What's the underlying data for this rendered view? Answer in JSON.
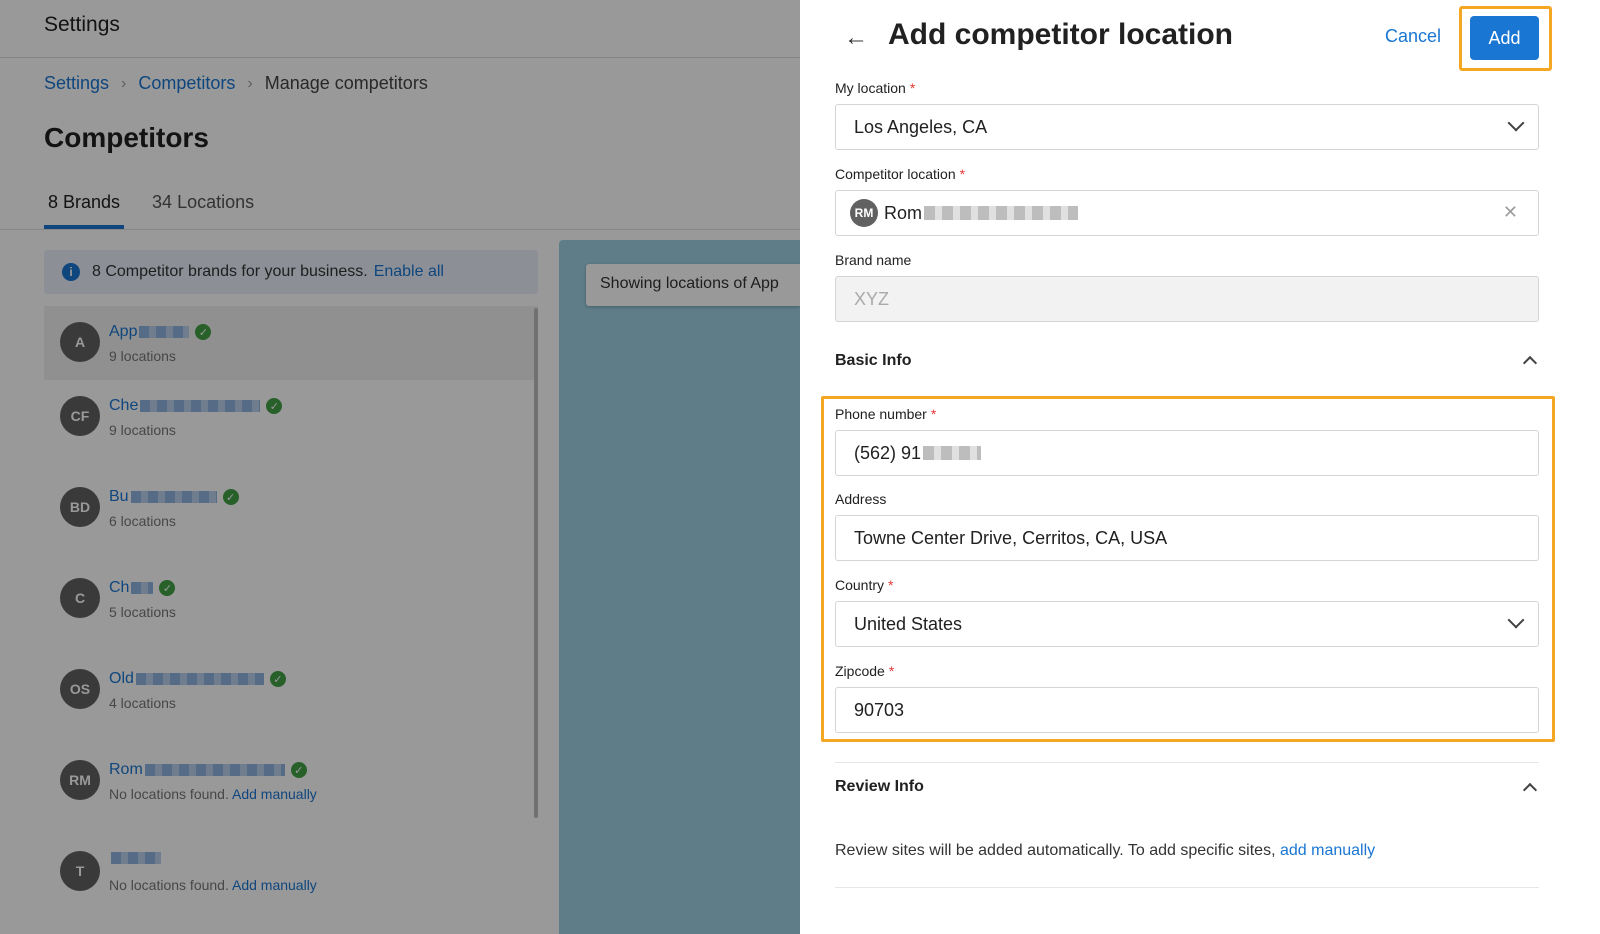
{
  "background": {
    "top_title": "Settings",
    "breadcrumb": [
      "Settings",
      "Competitors",
      "Manage competitors"
    ],
    "page_title": "Competitors",
    "tabs": [
      {
        "label": "8 Brands"
      },
      {
        "label": "34 Locations"
      }
    ],
    "info": {
      "text": "8 Competitor brands for your business.",
      "link": "Enable all"
    },
    "brands": [
      {
        "initials": "A",
        "name": "App",
        "sub": "9 locations",
        "add_link": ""
      },
      {
        "initials": "CF",
        "name": "Che",
        "sub": "9 locations",
        "add_link": ""
      },
      {
        "initials": "BD",
        "name": "Bu",
        "sub": "6 locations",
        "add_link": ""
      },
      {
        "initials": "C",
        "name": "Ch",
        "sub": "5 locations",
        "add_link": ""
      },
      {
        "initials": "OS",
        "name": "Old",
        "sub": "4 locations",
        "add_link": ""
      },
      {
        "initials": "RM",
        "name": "Rom",
        "sub": "No locations found.",
        "add_link": "Add manually"
      },
      {
        "initials": "T",
        "name": "",
        "sub": "No locations found.",
        "add_link": "Add manually"
      }
    ],
    "map_chip": "Showing locations of App"
  },
  "drawer": {
    "title": "Add competitor location",
    "cancel_label": "Cancel",
    "add_label": "Add",
    "my_location": {
      "label": "My location",
      "value": "Los Angeles, CA"
    },
    "competitor_location": {
      "label": "Competitor location",
      "avatar": "RM",
      "value": "Rom"
    },
    "brand_name": {
      "label": "Brand name",
      "placeholder": "XYZ"
    },
    "basic_info": {
      "title": "Basic Info",
      "phone": {
        "label": "Phone number",
        "value": "(562) 91"
      },
      "address": {
        "label": "Address",
        "value": "Towne Center Drive, Cerritos, CA, USA"
      },
      "country": {
        "label": "Country",
        "value": "United States"
      },
      "zipcode": {
        "label": "Zipcode",
        "value": "90703"
      }
    },
    "review_info": {
      "title": "Review Info",
      "text": "Review sites will be added automatically. To add specific sites,",
      "link": "add manually"
    }
  },
  "colors": {
    "accent": "#1976d2",
    "highlight": "#f5a623",
    "required": "#e53935",
    "verified": "#43a047"
  }
}
